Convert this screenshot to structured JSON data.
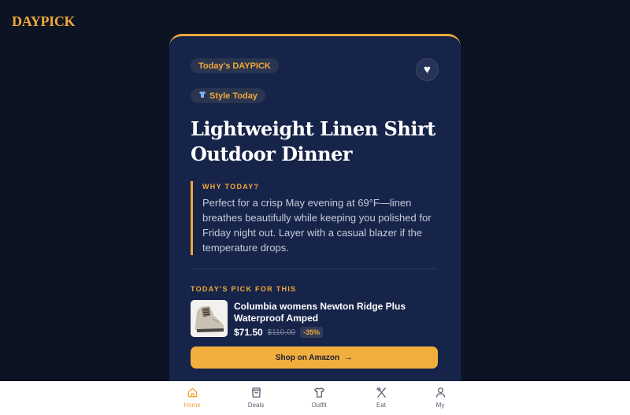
{
  "brand": {
    "logo": "DAYPICK"
  },
  "card": {
    "badge": "Today's DAYPICK",
    "category_icon": "shirt-icon",
    "category": "Style Today",
    "title": "Lightweight Linen Shirt Outdoor Dinner",
    "why_label": "WHY TODAY?",
    "why_text": "Perfect for a crisp May evening at 69°F—linen breathes beautifully while keeping you polished for Friday night out. Layer with a casual blazer if the temperature drops.",
    "pick_label": "TODAY'S PICK FOR THIS",
    "product": {
      "name": "Columbia womens Newton Ridge Plus Waterproof Amped",
      "price": "$71.50",
      "old_price": "$110.00",
      "discount": "-35%"
    },
    "shop_label": "Shop on Amazon",
    "shop_arrow": "→",
    "favorite_icon": "heart-icon"
  },
  "nav": {
    "items": [
      {
        "label": "Home",
        "icon": "home-icon",
        "active": true
      },
      {
        "label": "Deals",
        "icon": "bag-icon",
        "active": false
      },
      {
        "label": "Outfit",
        "icon": "shirt-icon",
        "active": false
      },
      {
        "label": "Eat",
        "icon": "utensils-icon",
        "active": false
      },
      {
        "label": "My",
        "icon": "user-icon",
        "active": false
      }
    ]
  },
  "colors": {
    "accent": "#f0a83a",
    "background": "#0c1424",
    "card": "#17244a",
    "nav_background": "#ffffff"
  }
}
